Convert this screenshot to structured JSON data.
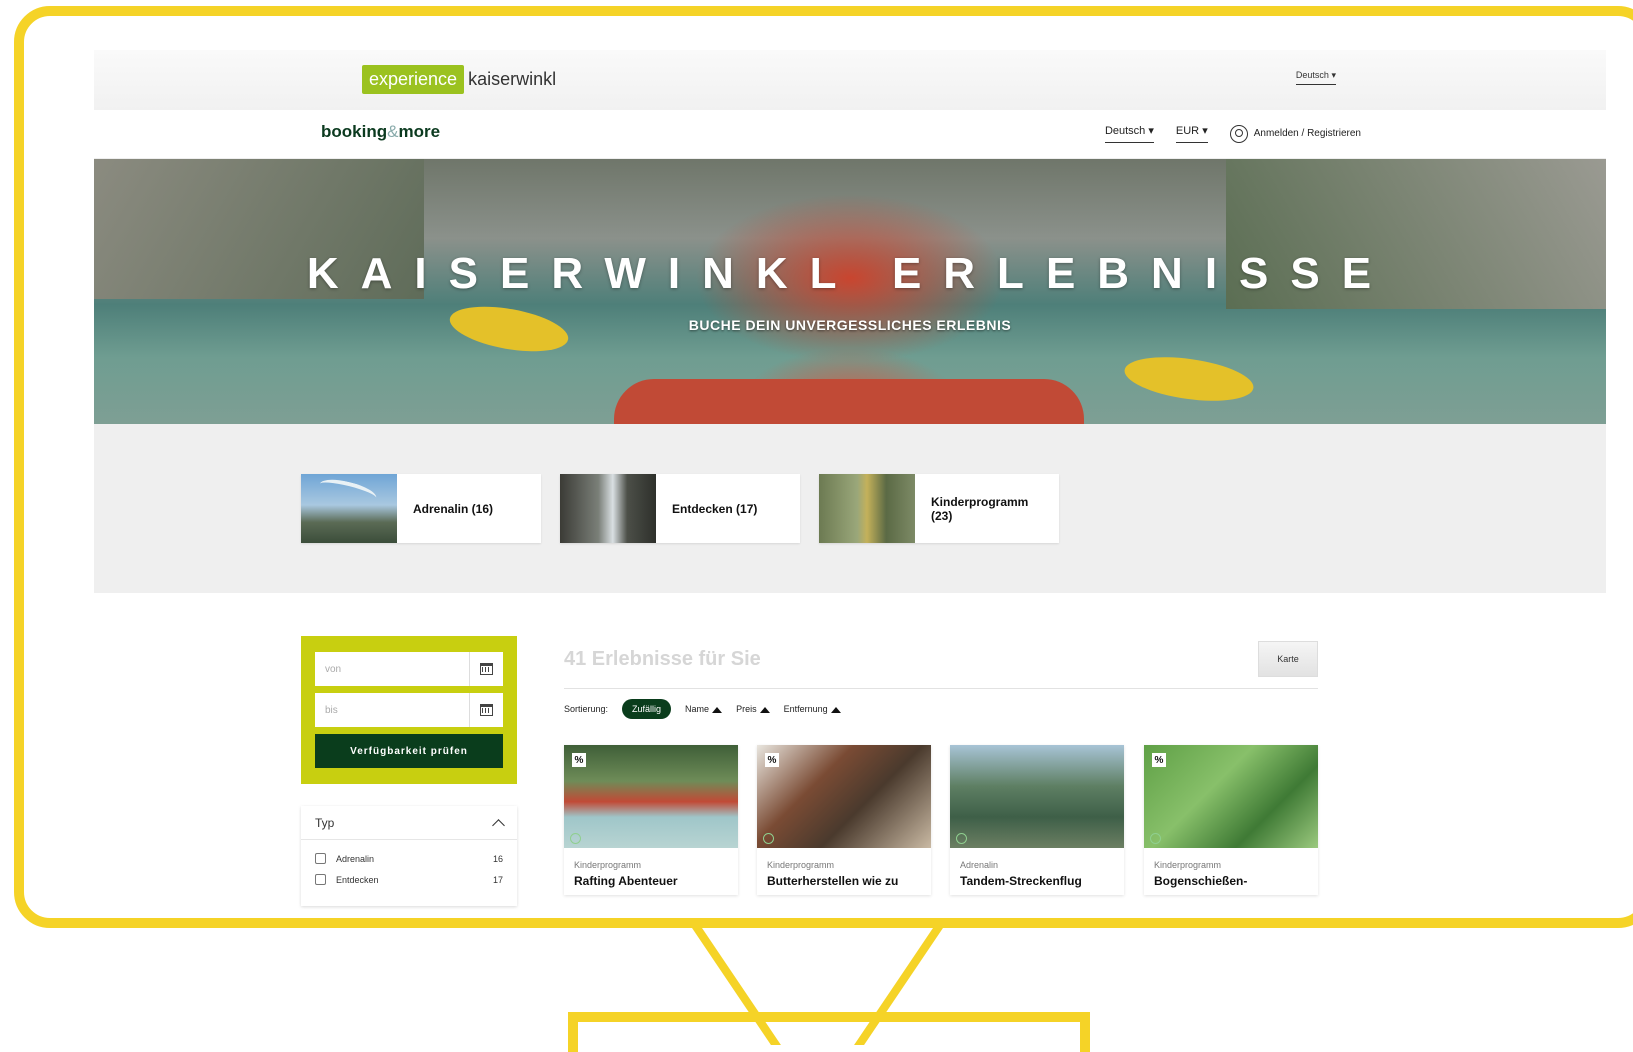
{
  "brand": {
    "logo_experience": "experience",
    "logo_kaiserwinkl": "kaiserwinkl",
    "language": "Deutsch"
  },
  "booking": {
    "logo_booking": "booking",
    "logo_amp": "&",
    "logo_more": "more",
    "language": "Deutsch",
    "currency": "EUR",
    "login": "Anmelden / Registrieren"
  },
  "hero": {
    "title": "KAISERWINKL ERLEBNISSE",
    "subtitle": "BUCHE DEIN UNVERGESSLICHES ERLEBNIS"
  },
  "categories": [
    {
      "label": "Adrenalin (16)"
    },
    {
      "label": "Entdecken (17)"
    },
    {
      "label": "Kinderprogramm (23)"
    }
  ],
  "filter": {
    "from_placeholder": "von",
    "to_placeholder": "bis",
    "check_button": "Verfügbarkeit prüfen",
    "type_title": "Typ",
    "types": [
      {
        "label": "Adrenalin",
        "count": "16"
      },
      {
        "label": "Entdecken",
        "count": "17"
      }
    ]
  },
  "results": {
    "heading": "41 Erlebnisse für Sie",
    "map_button": "Karte",
    "sort_label": "Sortierung:",
    "sort_options": [
      "Zufällig",
      "Name",
      "Preis",
      "Entfernung"
    ],
    "cards": [
      {
        "badge": "%",
        "category": "Kinderprogramm",
        "title": "Rafting Abenteuer"
      },
      {
        "badge": "%",
        "category": "Kinderprogramm",
        "title": "Butterherstellen wie zu"
      },
      {
        "badge": "",
        "category": "Adrenalin",
        "title": "Tandem-Streckenflug"
      },
      {
        "badge": "%",
        "category": "Kinderprogramm",
        "title": "Bogenschießen-"
      }
    ]
  },
  "colors": {
    "frame": "#f5d327",
    "accent_green": "#0a3d1c",
    "filter_yellow": "#c8cf10",
    "logo_green": "#9bc21f"
  }
}
